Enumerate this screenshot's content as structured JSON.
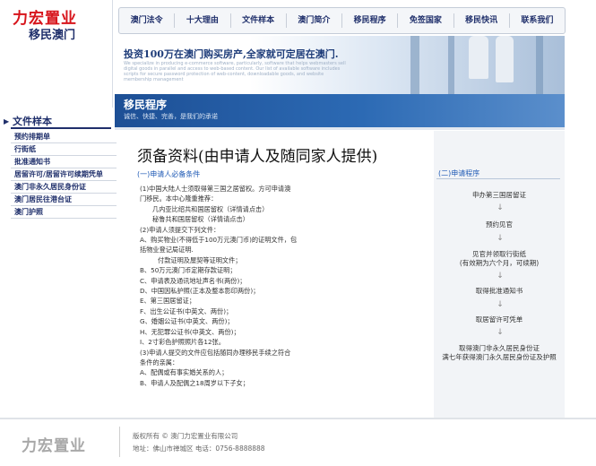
{
  "header": {
    "logo_main": "力宏置业",
    "logo_sub": "移民澳门"
  },
  "nav": {
    "items": [
      "澳门法令",
      "十大理由",
      "文件样本",
      "澳门简介",
      "移民程序",
      "免签国家",
      "移民快讯",
      "联系我们"
    ]
  },
  "banner": {
    "slogan": "投资100万在澳门购买房产,全家就可定居在澳门.",
    "english": "We specialize in producing e-commerce software, particularly, software that helps webmasters sell digital goods in parallel and access to web-based content. Our list of available software includes scripts for secure password protection of web-content, downloadable goods, and website membership management"
  },
  "program_bar": {
    "title": "移民程序",
    "subtitle": "诚信、快捷、完善，是我们的承诺"
  },
  "sidebar": {
    "title": "文件样本",
    "items": [
      "预约排期单",
      "行街纸",
      "批准通知书",
      "居留许可/居留许可续期凭单",
      "澳门非永久居民身份证",
      "澳门居民往港台证",
      "澳门护照"
    ]
  },
  "content": {
    "title": "须备资料(由申请人及随同家人提供)",
    "section_label": "(一)申请人必备条件",
    "lines": [
      "(1)中国大陆人士须取得第三国之居留权。方可申请澳",
      "门移民。本中心隆重推荐：",
      "几内亚比绍共和国居留权（详情请点击）",
      "秘鲁共和国居留权（详情请点击）",
      "(2)申请人须提交下列文件：",
      "A、购买物业(不得低于100万元澳门币)的证明文件，包",
      "括物业登记局证明.",
      "付款证明及屋契等证明文件；",
      "B、50万元澳门币定期存款证明；",
      "C、申请表及通讯地址声名书(两份)；",
      "D、中国因私护照(正本及整本影印两份)；",
      "E、第三国居留证；",
      "F、出生公证书(中英文、两份)；",
      "G、婚姻公证书(中英文、两份)；",
      "H、无犯罪公证书(中英文、两份)；",
      "I、2寸彩色护照照片各12张。",
      "(3)申请人提交的文件应包括随同办理移民手续之符合",
      "条件的亲属：",
      "A、配偶或有事实婚关系的人；",
      "B、申请人及配偶之18周岁以下子女；"
    ]
  },
  "flow": {
    "header": "(二)申请程序",
    "steps": [
      "申办第三国居留证",
      "预约见官",
      "见官并领取行街纸",
      "(有效期为六个月，可续期)",
      "取得批准通知书",
      "取居留许可凭单",
      "取得澳门非永久居民身份证",
      "满七年获得澳门永久居民身份证及护照"
    ]
  },
  "footer": {
    "logo": "力宏置业",
    "copyright": "版权所有 © 澳门力宏置业有限公司",
    "address": "地址：佛山市禅城区    电话：0756-8888888"
  }
}
